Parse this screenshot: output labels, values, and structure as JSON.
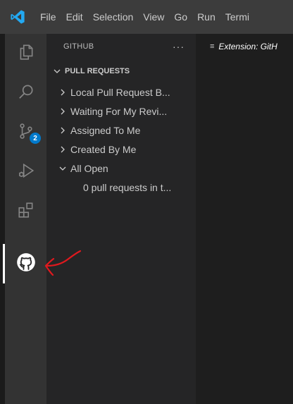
{
  "menu": {
    "items": [
      "File",
      "Edit",
      "Selection",
      "View",
      "Go",
      "Run",
      "Termi"
    ]
  },
  "activity_bar": {
    "items": [
      {
        "icon": "explorer-icon"
      },
      {
        "icon": "search-icon"
      },
      {
        "icon": "source-control-icon",
        "badge": "2"
      },
      {
        "icon": "run-debug-icon"
      },
      {
        "icon": "extensions-icon"
      },
      {
        "icon": "github-icon",
        "active": true
      }
    ]
  },
  "sidebar": {
    "title": "GITHUB",
    "more_actions": "···",
    "section": {
      "label": "PULL REQUESTS",
      "expanded": true,
      "items": [
        {
          "label": "Local Pull Request B...",
          "expanded": false
        },
        {
          "label": "Waiting For My Revi...",
          "expanded": false
        },
        {
          "label": "Assigned To Me",
          "expanded": false
        },
        {
          "label": "Created By Me",
          "expanded": false
        },
        {
          "label": "All Open",
          "expanded": true
        },
        {
          "label": "0 pull requests in t...",
          "child": true
        }
      ]
    }
  },
  "editor": {
    "tab_icon": "≡",
    "tab_label": "Extension: GitH"
  },
  "colors": {
    "titlebar": "#3c3c3c",
    "activity_bar": "#333333",
    "sidebar": "#252526",
    "editor": "#1e1e1e",
    "badge": "#007acc",
    "vscode_logo": "#23a9f2",
    "annotation_arrow": "#e0191e"
  }
}
